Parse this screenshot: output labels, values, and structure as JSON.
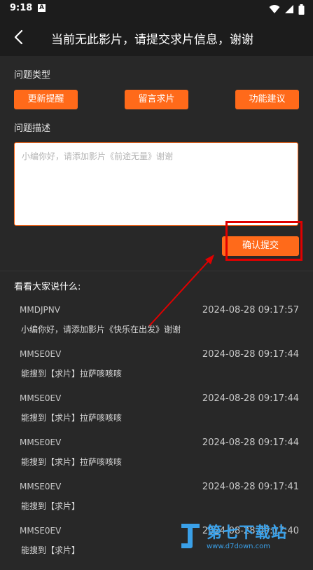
{
  "status_bar": {
    "time": "9:18",
    "notification_letter": "A"
  },
  "header": {
    "title": "当前无此影片，请提交求片信息，谢谢"
  },
  "problem_type": {
    "label": "问题类型",
    "options": [
      "更新提醒",
      "留言求片",
      "功能建议"
    ]
  },
  "description": {
    "label": "问题描述",
    "placeholder": "小编你好，请添加影片《前途无量》谢谢"
  },
  "submit_label": "确认提交",
  "comments": {
    "title": "看看大家说什么:",
    "items": [
      {
        "user": "MMDJPNV",
        "time": "2024-08-28 09:17:57",
        "text": "小编你好，请添加影片《快乐在出发》谢谢"
      },
      {
        "user": "MMSE0EV",
        "time": "2024-08-28 09:17:44",
        "text": "能搜到【求片】拉萨咳咳咳"
      },
      {
        "user": "MMSE0EV",
        "time": "2024-08-28 09:17:44",
        "text": "能搜到【求片】拉萨咳咳咳"
      },
      {
        "user": "MMSE0EV",
        "time": "2024-08-28 09:17:44",
        "text": "能搜到【求片】拉萨咳咳咳"
      },
      {
        "user": "MMSE0EV",
        "time": "2024-08-28 09:17:41",
        "text": "能搜到【求片】"
      },
      {
        "user": "MMSE0EV",
        "time": "2024-08-28 09:17:40",
        "text": "能搜到【求片】"
      }
    ]
  },
  "watermark": {
    "text": "第七下载站",
    "url": "www.d7down.com"
  },
  "colors": {
    "accent": "#ff6a1a",
    "background": "#282828",
    "header": "#1c1c1c",
    "annotation": "#e00000"
  },
  "icons": {
    "back": "arrow-left-icon",
    "wifi": "wifi-icon",
    "signal": "signal-icon",
    "battery": "battery-icon"
  }
}
